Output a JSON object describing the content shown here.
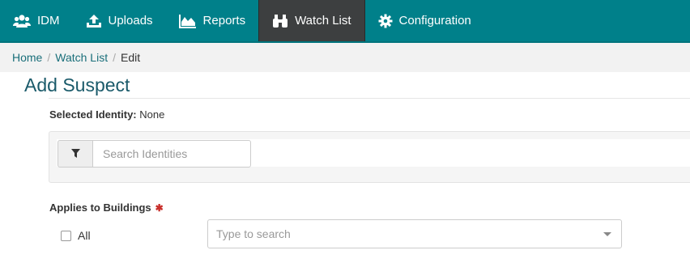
{
  "nav": {
    "items": [
      {
        "label": "IDM",
        "icon": "users-icon"
      },
      {
        "label": "Uploads",
        "icon": "upload-icon"
      },
      {
        "label": "Reports",
        "icon": "area-chart-icon"
      },
      {
        "label": "Watch List",
        "icon": "binoculars-icon",
        "active": true
      },
      {
        "label": "Configuration",
        "icon": "gear-icon"
      }
    ]
  },
  "breadcrumb": {
    "home": "Home",
    "sep": "/",
    "watchlist": "Watch List",
    "current": "Edit"
  },
  "page": {
    "title": "Add Suspect",
    "selected_identity_label": "Selected Identity:",
    "selected_identity_value": "None"
  },
  "search": {
    "placeholder": "Search Identities",
    "filter_icon": "filter-icon"
  },
  "buildings": {
    "label": "Applies to Buildings",
    "required_mark": "✱",
    "all_label": "All",
    "all_checked": false,
    "select_placeholder": "Type to search"
  },
  "colors": {
    "nav_bg": "#00808a",
    "nav_active_bg": "#3d3f40",
    "title": "#1a5a6a",
    "link": "#1a6f7a",
    "required": "#c9302c"
  }
}
